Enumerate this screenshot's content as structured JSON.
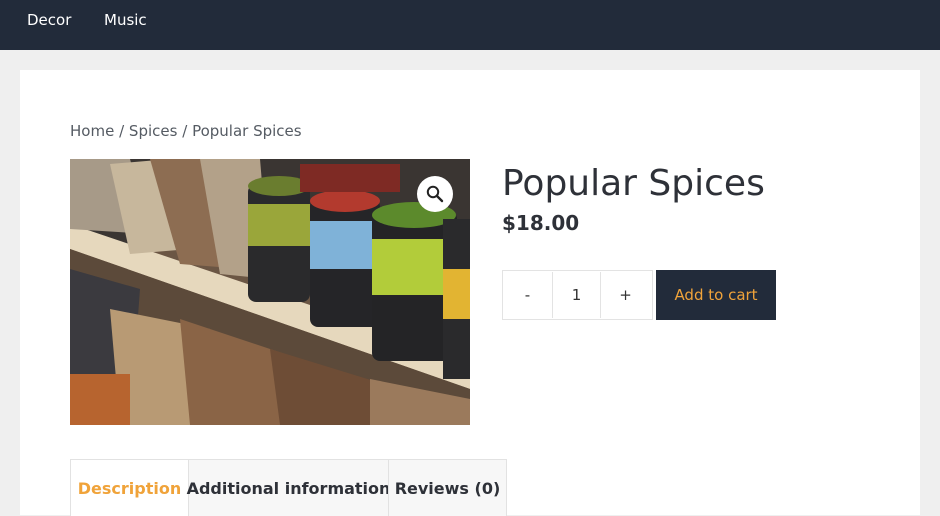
{
  "nav": {
    "items": [
      {
        "label": "Decor"
      },
      {
        "label": "Music"
      }
    ]
  },
  "breadcrumb": {
    "home": "Home",
    "category": "Spices",
    "current": "Popular Spices",
    "separator": "/"
  },
  "product": {
    "title": "Popular Spices",
    "price": "$18.00",
    "image_icon": "zoom-magnifier-icon"
  },
  "quantity": {
    "minus_label": "-",
    "value": "1",
    "plus_label": "+"
  },
  "cart": {
    "add_label": "Add to cart"
  },
  "tabs": [
    {
      "label": "Description",
      "active": true
    },
    {
      "label": "Additional information",
      "active": false
    },
    {
      "label": "Reviews (0)",
      "active": false
    }
  ],
  "colors": {
    "header_bg": "#222b3a",
    "accent": "#f0a33a",
    "page_bg": "#efefef",
    "text": "#2e3138"
  }
}
